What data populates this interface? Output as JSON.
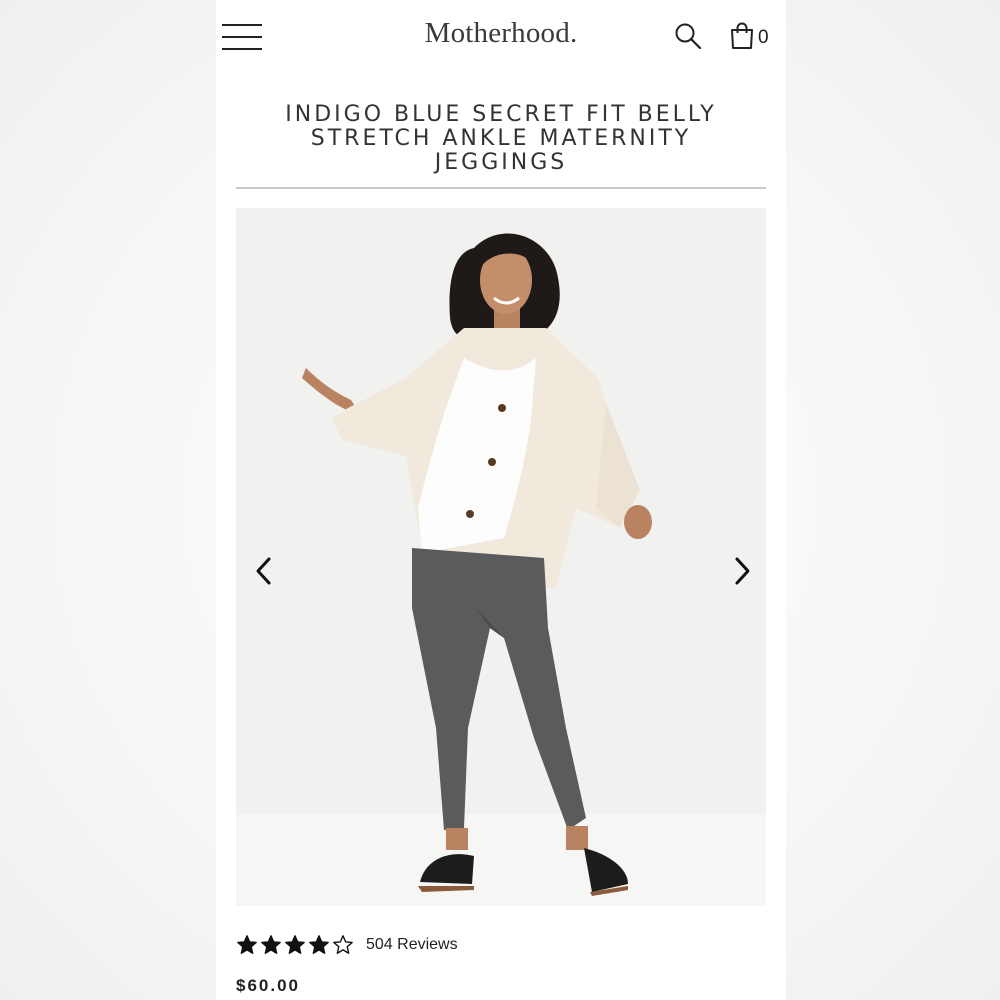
{
  "header": {
    "logo": "Motherhood.",
    "cart_count": "0",
    "icons": {
      "menu": "hamburger-menu-icon",
      "search": "search-icon",
      "cart": "shopping-bag-icon"
    }
  },
  "product": {
    "title": "INDIGO BLUE SECRET FIT BELLY STRETCH ANKLE MATERNITY JEGGINGS",
    "image": "model-photo-cream-cardigan-gray-jeggings",
    "rating_stars": 4,
    "rating_max": 5,
    "reviews_label": "504 Reviews",
    "price": "$60.00"
  },
  "carousel": {
    "prev_icon": "chevron-left-icon",
    "next_icon": "chevron-right-icon"
  },
  "colors": {
    "text": "#222222",
    "divider": "#c9c9c9",
    "image_bg": "#f1f1f0",
    "cardigan": "#f1e9dc",
    "jeans": "#5b5b5d"
  }
}
